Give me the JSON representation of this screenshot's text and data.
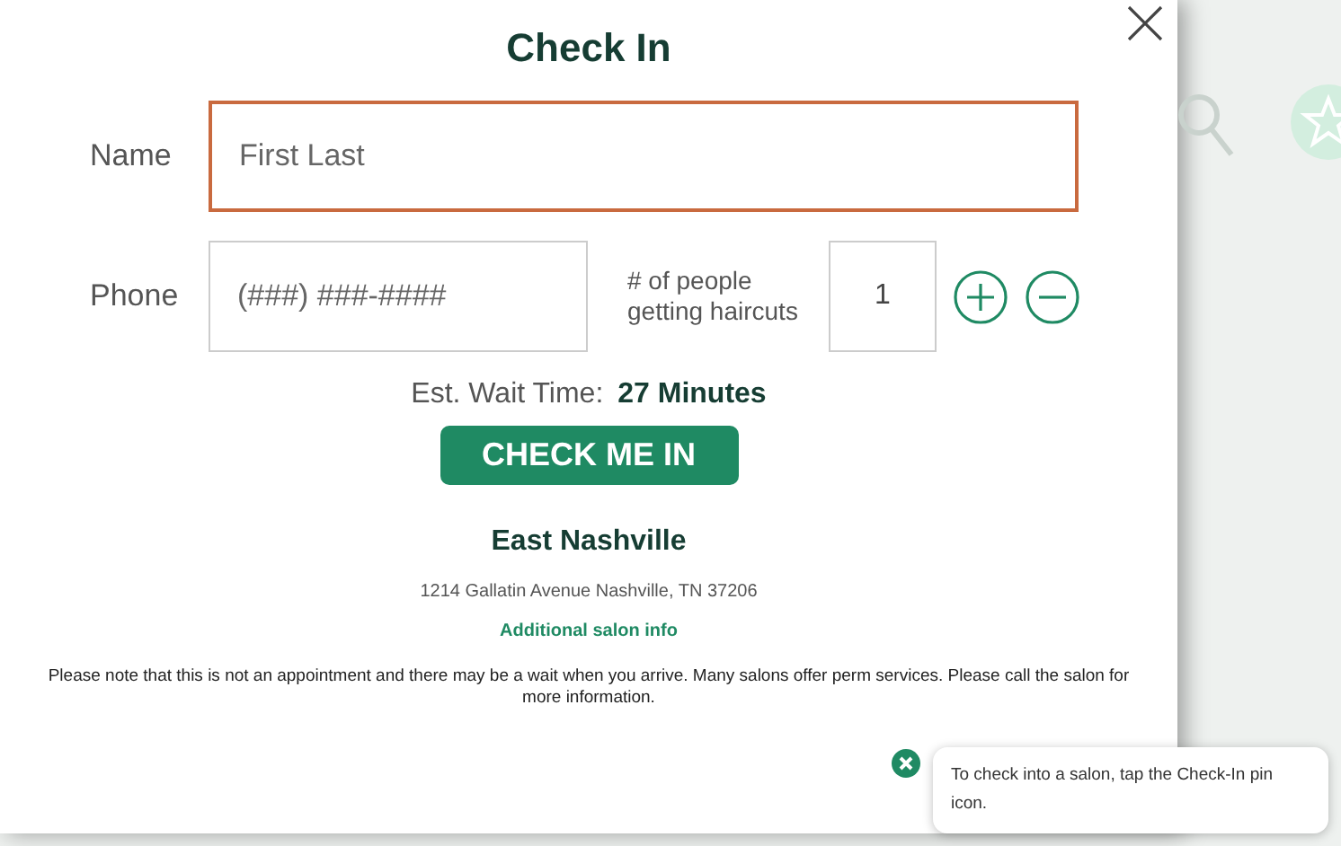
{
  "dialog": {
    "title": "Check In",
    "name_field": {
      "label": "Name",
      "placeholder": "First Last",
      "focused": true
    },
    "phone_field": {
      "label": "Phone",
      "placeholder": "(###) ###-####",
      "focused": false
    },
    "people": {
      "label": "# of people getting haircuts",
      "value": "1"
    },
    "wait": {
      "label": "Est. Wait Time:",
      "value": "27 Minutes"
    },
    "submit": "CHECK ME IN",
    "salon": {
      "name": "East Nashville",
      "address": "1214 Gallatin Avenue Nashville, TN 37206",
      "link": "Additional salon info"
    },
    "note": "Please note that this is not an appointment and there may be a wait when you arrive. Many salons offer perm services. Please call the salon for more information."
  },
  "tooltip": {
    "text": "To check into a salon, tap the Check-In pin icon."
  }
}
